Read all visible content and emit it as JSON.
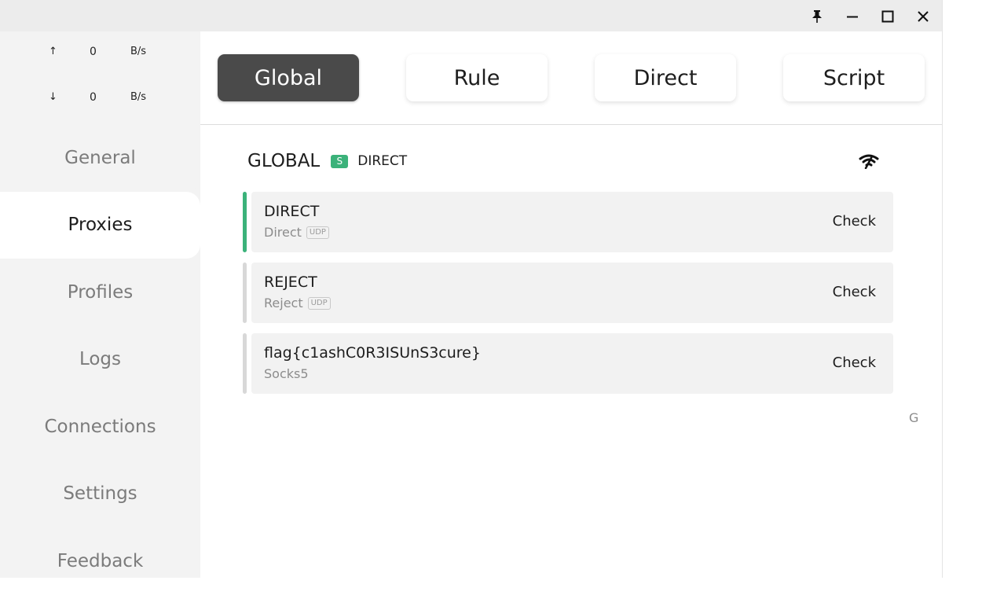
{
  "window_controls": {
    "pin": "pin-icon",
    "minimize": "minimize-icon",
    "maximize": "maximize-icon",
    "close": "close-icon"
  },
  "speed": {
    "upload_arrow": "↑",
    "upload_value": "0",
    "upload_unit": "B/s",
    "download_arrow": "↓",
    "download_value": "0",
    "download_unit": "B/s"
  },
  "sidebar": {
    "items": [
      {
        "label": "General"
      },
      {
        "label": "Proxies"
      },
      {
        "label": "Profiles"
      },
      {
        "label": "Logs"
      },
      {
        "label": "Connections"
      },
      {
        "label": "Settings"
      },
      {
        "label": "Feedback"
      }
    ],
    "active": "Proxies"
  },
  "modes": {
    "items": [
      {
        "label": "Global"
      },
      {
        "label": "Rule"
      },
      {
        "label": "Direct"
      },
      {
        "label": "Script"
      }
    ],
    "active": "Global"
  },
  "group": {
    "name": "GLOBAL",
    "badge": "S",
    "current": "DIRECT",
    "latency_icon": "wifi-icon"
  },
  "proxies": [
    {
      "name": "DIRECT",
      "type": "Direct",
      "udp": "UDP",
      "action": "Check",
      "selected": true
    },
    {
      "name": "REJECT",
      "type": "Reject",
      "udp": "UDP",
      "action": "Check",
      "selected": false
    },
    {
      "name": "flag{c1ashC0R3ISUnS3cure}",
      "type": "Socks5",
      "action": "Check",
      "selected": false
    }
  ],
  "scroll_letter": "G",
  "colors": {
    "accent": "#3bb27a",
    "active_mode_bg": "#4a4a4a",
    "sidebar_bg": "#f3f3f3",
    "card_bg": "#f2f2f2"
  }
}
